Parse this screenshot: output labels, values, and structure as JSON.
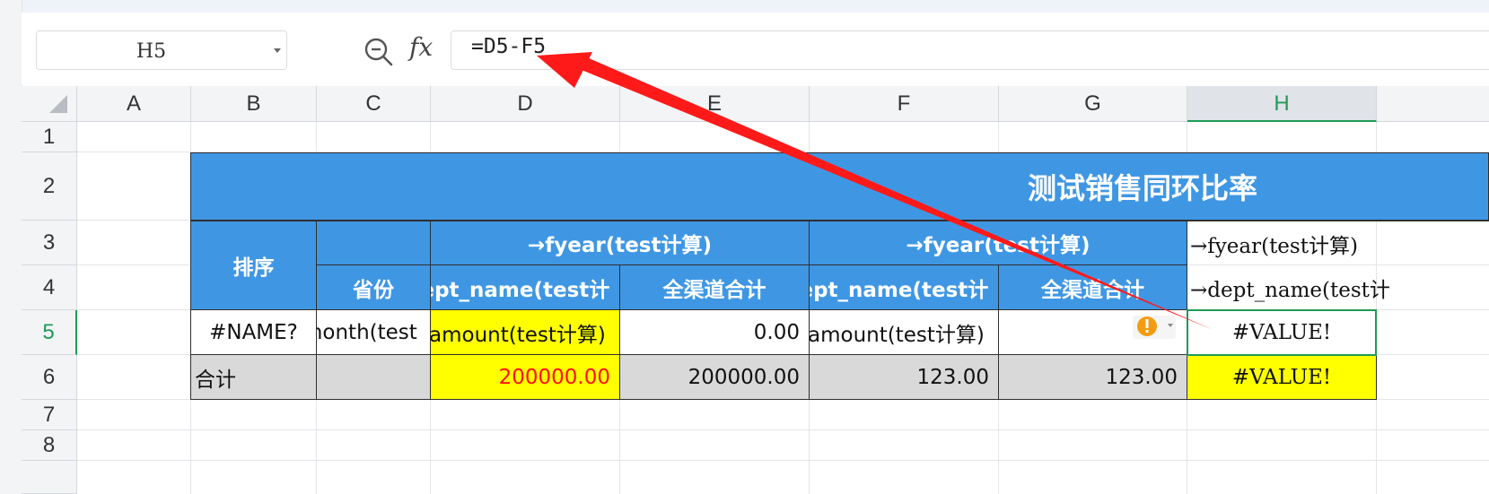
{
  "name_box": {
    "value": "H5"
  },
  "formula_bar": {
    "fx_label": "fx",
    "formula": "=D5-F5"
  },
  "columns": [
    "A",
    "B",
    "C",
    "D",
    "E",
    "F",
    "G",
    "H"
  ],
  "rows": [
    "1",
    "2",
    "3",
    "4",
    "5",
    "6",
    "7",
    "8"
  ],
  "selected": {
    "column": "H",
    "row": "5"
  },
  "sheet": {
    "title": "测试销售同环比率",
    "header_sort": "排序",
    "header_fyear_1": "→fyear(test计算)",
    "header_fyear_2": "→fyear(test计算)",
    "header_fyear_3": "→fyear(test计算)",
    "header_province": "省份",
    "header_dept_1": "dept_name(test计",
    "header_all_1": "全渠道合计",
    "header_dept_2": "dept_name(test计",
    "header_all_2": "全渠道合计",
    "header_dept_3": "→dept_name(test计",
    "row5": {
      "b": "#NAME?",
      "c": "month(test",
      "d": "amount(test计算)",
      "e": "0.00",
      "f": "amount(test计算)",
      "h": "#VALUE!"
    },
    "row6": {
      "b": "合计",
      "d": "200000.00",
      "e": "200000.00",
      "f": "123.00",
      "g": "123.00",
      "h": "#VALUE!"
    }
  },
  "colors": {
    "header_blue": "#3f97e4",
    "highlight_yellow": "#ffff00",
    "total_gray": "#d9d9d9",
    "error_orange": "#f39c12",
    "annotation_red": "#ff1a1a",
    "selection_green": "#1e9b55"
  }
}
